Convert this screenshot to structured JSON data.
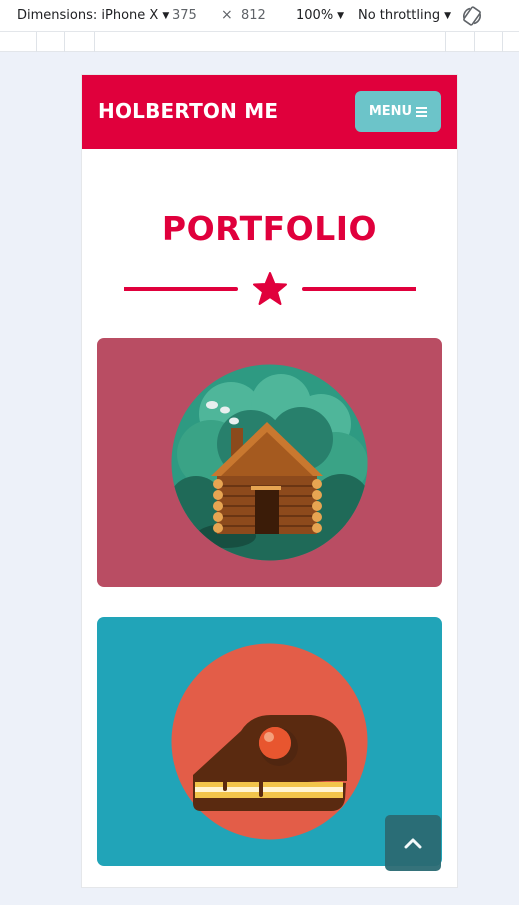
{
  "devtools": {
    "dimensions_label": "Dimensions: iPhone X",
    "width_value": "375",
    "height_value": "812",
    "zoom": "100%",
    "throttling": "No throttling"
  },
  "site": {
    "brand": "HOLBERTON ME",
    "menu_label": "MENU",
    "section_title": "PORTFOLIO"
  },
  "portfolio": [
    {
      "name": "cabin",
      "background": "#b94d63"
    },
    {
      "name": "cake",
      "background": "#21a4b8"
    }
  ],
  "colors": {
    "accent": "#e0003c",
    "menu_button": "#6cc4c9"
  },
  "icons": [
    "rotate-icon",
    "star-icon",
    "menu-bars-icon",
    "chevron-up-icon"
  ]
}
